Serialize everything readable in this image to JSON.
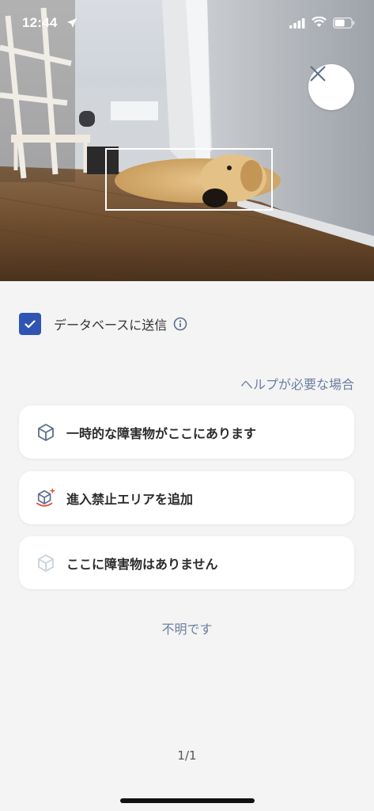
{
  "status_bar": {
    "time": "12:44",
    "icons": [
      "location-arrow-icon",
      "cellular-signal-icon",
      "wifi-icon",
      "battery-icon"
    ]
  },
  "camera": {
    "close_icon": "close-icon",
    "detection": "detection-box"
  },
  "database": {
    "checked": true,
    "label": "データベースに送信",
    "info_icon": "info-icon"
  },
  "help_link": "ヘルプが必要な場合",
  "options": [
    {
      "label": "一時的な障害物がここにあります",
      "icon": "cube-icon"
    },
    {
      "label": "進入禁止エリアを追加",
      "icon": "no-go-zone-cube-icon"
    },
    {
      "label": "ここに障害物はありません",
      "icon": "faded-cube-icon"
    }
  ],
  "unknown_label": "不明です",
  "page_indicator": "1/1",
  "colors": {
    "accent": "#2f54b3",
    "link": "#6b7fa0",
    "background": "#f4f4f4",
    "card": "#ffffff",
    "warning": "#e2533a"
  }
}
